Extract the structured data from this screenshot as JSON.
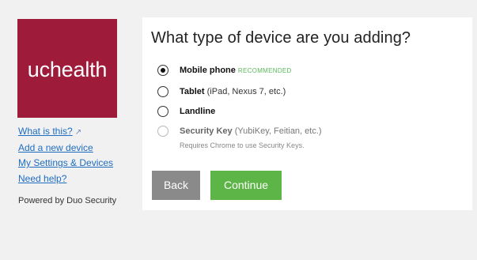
{
  "logo": {
    "text": "uchealth",
    "color": "#9e1b3a"
  },
  "sidebar": {
    "links": [
      {
        "label": "What is this?"
      },
      {
        "label": "Add a new device"
      },
      {
        "label": "My Settings & Devices"
      },
      {
        "label": "Need help?"
      }
    ],
    "external_icon": "↗",
    "powered_by": "Powered by Duo Security"
  },
  "main": {
    "title": "What type of device are you adding?",
    "options": [
      {
        "label": "Mobile phone",
        "badge": "RECOMMENDED",
        "selected": true
      },
      {
        "label": "Tablet",
        "detail": " (iPad, Nexus 7, etc.)",
        "selected": false
      },
      {
        "label": "Landline",
        "selected": false
      },
      {
        "label": "Security Key",
        "detail": " (YubiKey, Feitian, etc.)",
        "note": "Requires Chrome to use Security Keys.",
        "selected": false,
        "disabled": true
      }
    ],
    "buttons": {
      "back": "Back",
      "continue": "Continue"
    },
    "colors": {
      "continue": "#5cb546",
      "back": "#8a8a8a",
      "recommended": "#5cb85c"
    }
  }
}
